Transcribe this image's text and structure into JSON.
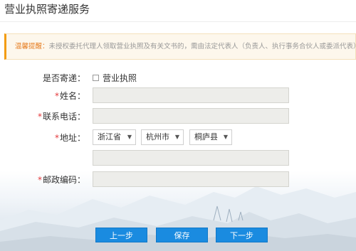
{
  "page": {
    "title": "营业执照寄递服务"
  },
  "notice": {
    "lead": "温馨提醒：",
    "text": "未授权委托代理人领取营业执照及有关文书的，需由法定代表人（负责人、执行事务合伙人或委派代表）作为邮寄"
  },
  "form": {
    "mail_label": "是否寄递：",
    "mail_option": "营业执照",
    "mail_checked": false,
    "name_label": "姓名：",
    "name_value": "",
    "phone_label": "联系电话：",
    "phone_value": "",
    "address_label": "地址：",
    "province": "浙江省",
    "city": "杭州市",
    "county": "桐庐县",
    "address_detail": "",
    "postcode_label": "邮政编码：",
    "postcode_value": "",
    "required_mark": "*"
  },
  "buttons": {
    "prev": "上一步",
    "save": "保存",
    "next": "下一步"
  },
  "colors": {
    "accent": "#1a8be0",
    "required": "#e4393c",
    "notice_border": "#f39c12",
    "notice_bg": "#fdf7ec"
  }
}
